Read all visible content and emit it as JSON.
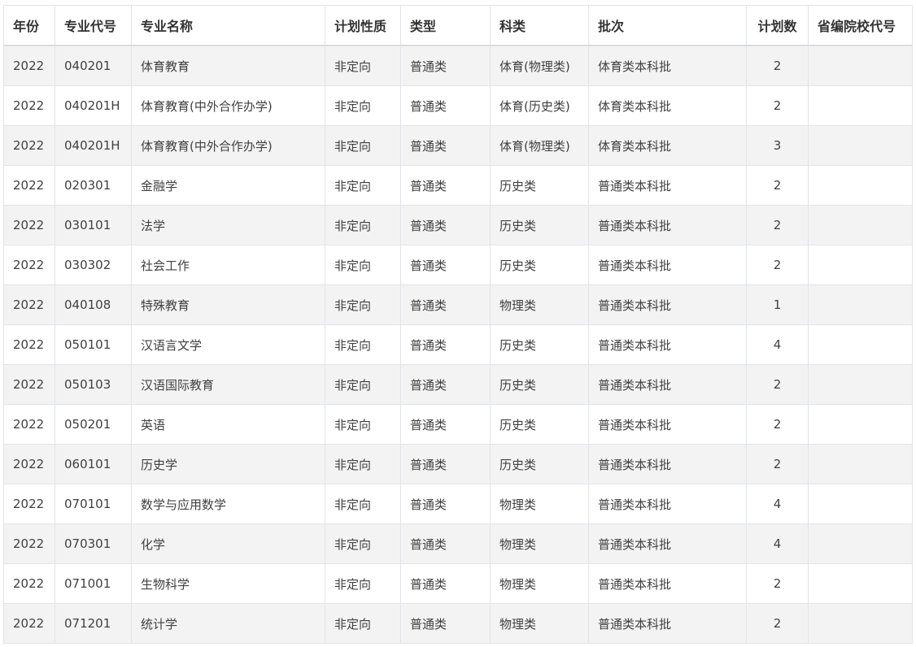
{
  "table": {
    "headers": [
      "年份",
      "专业代号",
      "专业名称",
      "计划性质",
      "类型",
      "科类",
      "批次",
      "计划数",
      "省编院校代号"
    ],
    "rows": [
      [
        "2022",
        "040201",
        "体育教育",
        "非定向",
        "普通类",
        "体育(物理类)",
        "体育类本科批",
        "2",
        ""
      ],
      [
        "2022",
        "040201H",
        "体育教育(中外合作办学)",
        "非定向",
        "普通类",
        "体育(历史类)",
        "体育类本科批",
        "2",
        ""
      ],
      [
        "2022",
        "040201H",
        "体育教育(中外合作办学)",
        "非定向",
        "普通类",
        "体育(物理类)",
        "体育类本科批",
        "3",
        ""
      ],
      [
        "2022",
        "020301",
        "金融学",
        "非定向",
        "普通类",
        "历史类",
        "普通类本科批",
        "2",
        ""
      ],
      [
        "2022",
        "030101",
        "法学",
        "非定向",
        "普通类",
        "历史类",
        "普通类本科批",
        "2",
        ""
      ],
      [
        "2022",
        "030302",
        "社会工作",
        "非定向",
        "普通类",
        "历史类",
        "普通类本科批",
        "2",
        ""
      ],
      [
        "2022",
        "040108",
        "特殊教育",
        "非定向",
        "普通类",
        "物理类",
        "普通类本科批",
        "1",
        ""
      ],
      [
        "2022",
        "050101",
        "汉语言文学",
        "非定向",
        "普通类",
        "历史类",
        "普通类本科批",
        "4",
        ""
      ],
      [
        "2022",
        "050103",
        "汉语国际教育",
        "非定向",
        "普通类",
        "历史类",
        "普通类本科批",
        "2",
        ""
      ],
      [
        "2022",
        "050201",
        "英语",
        "非定向",
        "普通类",
        "历史类",
        "普通类本科批",
        "2",
        ""
      ],
      [
        "2022",
        "060101",
        "历史学",
        "非定向",
        "普通类",
        "历史类",
        "普通类本科批",
        "2",
        ""
      ],
      [
        "2022",
        "070101",
        "数学与应用数学",
        "非定向",
        "普通类",
        "物理类",
        "普通类本科批",
        "4",
        ""
      ],
      [
        "2022",
        "070301",
        "化学",
        "非定向",
        "普通类",
        "物理类",
        "普通类本科批",
        "4",
        ""
      ],
      [
        "2022",
        "071001",
        "生物科学",
        "非定向",
        "普通类",
        "物理类",
        "普通类本科批",
        "2",
        ""
      ],
      [
        "2022",
        "071201",
        "统计学",
        "非定向",
        "普通类",
        "物理类",
        "普通类本科批",
        "2",
        ""
      ]
    ]
  }
}
